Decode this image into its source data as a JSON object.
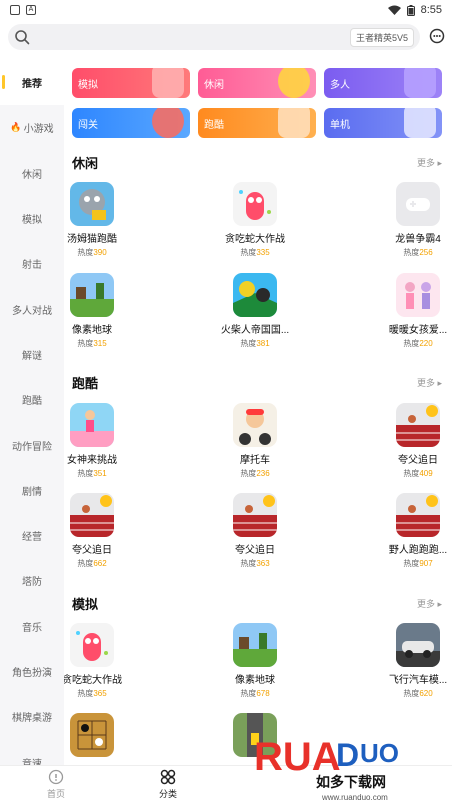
{
  "status": {
    "time": "8:55"
  },
  "search": {
    "placeholder": "",
    "tag": "王者精英5V5"
  },
  "sidebar": {
    "items": [
      {
        "label": "推荐"
      },
      {
        "label": "小游戏"
      },
      {
        "label": "休闲"
      },
      {
        "label": "模拟"
      },
      {
        "label": "射击"
      },
      {
        "label": "多人对战"
      },
      {
        "label": "解谜"
      },
      {
        "label": "跑酷"
      },
      {
        "label": "动作冒险"
      },
      {
        "label": "剧情"
      },
      {
        "label": "经营"
      },
      {
        "label": "塔防"
      },
      {
        "label": "音乐"
      },
      {
        "label": "角色扮演"
      },
      {
        "label": "棋牌桌游"
      },
      {
        "label": "竞速"
      }
    ]
  },
  "categories": [
    {
      "label": "模拟",
      "color": "#ff5a6e"
    },
    {
      "label": "休闲",
      "color": "#ff6aa0"
    },
    {
      "label": "多人",
      "color": "#8a66f2"
    },
    {
      "label": "闯关",
      "color": "#3a8cff"
    },
    {
      "label": "跑酷",
      "color": "#ff9a2e"
    },
    {
      "label": "单机",
      "color": "#6a7cf0"
    }
  ],
  "heat_label": "热度",
  "sections": [
    {
      "title": "休闲",
      "more": "更多",
      "games": [
        {
          "name": "汤姆猫跑酷",
          "heat": "390",
          "icon": "talking-tom-icon"
        },
        {
          "name": "贪吃蛇大作战",
          "heat": "335",
          "icon": "snake-icon"
        },
        {
          "name": "龙兽争霸4",
          "heat": "256",
          "icon": "gamepad-placeholder-icon"
        },
        {
          "name": "像素地球",
          "heat": "315",
          "icon": "pixel-earth-icon"
        },
        {
          "name": "火柴人帝国国...",
          "heat": "381",
          "icon": "stickman-icon"
        },
        {
          "name": "暖暖女孩爱...",
          "heat": "220",
          "icon": "dressup-girl-icon"
        }
      ]
    },
    {
      "title": "跑酷",
      "more": "更多",
      "games": [
        {
          "name": "女神来挑战",
          "heat": "351",
          "icon": "runner-girl-icon"
        },
        {
          "name": "摩托车",
          "heat": "236",
          "icon": "motorbike-icon"
        },
        {
          "name": "夸父追日",
          "heat": "409",
          "icon": "track-sun-icon"
        },
        {
          "name": "夸父追日",
          "heat": "662",
          "icon": "track-sun-icon"
        },
        {
          "name": "夸父追日",
          "heat": "363",
          "icon": "track-sun-icon"
        },
        {
          "name": "野人跑跑跑...",
          "heat": "907",
          "icon": "track-sun-icon"
        }
      ]
    },
    {
      "title": "模拟",
      "more": "更多",
      "games": [
        {
          "name": "贪吃蛇大作战",
          "heat": "365",
          "icon": "snake-icon"
        },
        {
          "name": "像素地球",
          "heat": "678",
          "icon": "pixel-earth-icon"
        },
        {
          "name": "飞行汽车模...",
          "heat": "620",
          "icon": "flying-car-icon"
        }
      ]
    }
  ],
  "bottom_nav": [
    {
      "label": "首页"
    },
    {
      "label": "分类"
    }
  ],
  "watermark": {
    "logo": "RUANDUO",
    "tagline": "如多下载网",
    "url": "www.ruanduo.com"
  }
}
